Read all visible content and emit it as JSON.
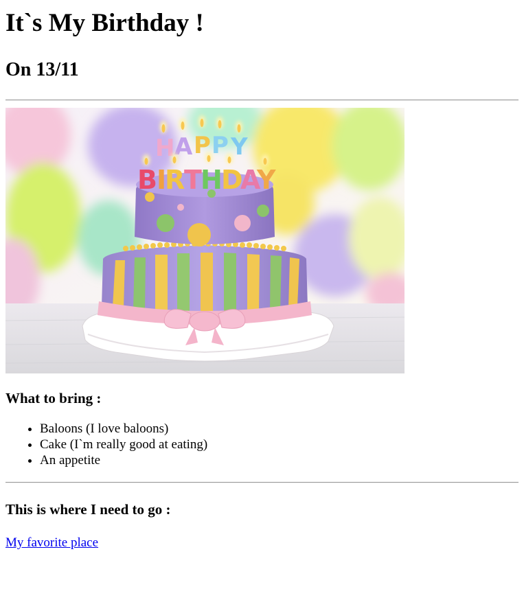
{
  "page": {
    "title": "It`s My Birthday !",
    "date_heading": "On 13/11"
  },
  "image": {
    "subject": "birthday-cake-with-balloons",
    "candle_letters": "HAPPY BIRTHDAY",
    "colors": {
      "background_balloons": [
        "#c8b8f0",
        "#d8f070",
        "#f8e060",
        "#b8f0c8",
        "#f8c0d8"
      ],
      "cake_top": "#a890d8",
      "cake_dots": [
        "#e8c050",
        "#88c070",
        "#f0b0c8"
      ],
      "stripes": [
        "#f0c850",
        "#98c870",
        "#a890d8"
      ],
      "ribbon": "#f4b8cc",
      "plate": "#ffffff"
    }
  },
  "bring": {
    "heading": "What to bring :",
    "items": [
      "Baloons (I love baloons)",
      "Cake (I`m really good at eating)",
      "An appetite"
    ]
  },
  "where": {
    "heading": "This is where I need to go :",
    "link_text": "My favorite place"
  }
}
